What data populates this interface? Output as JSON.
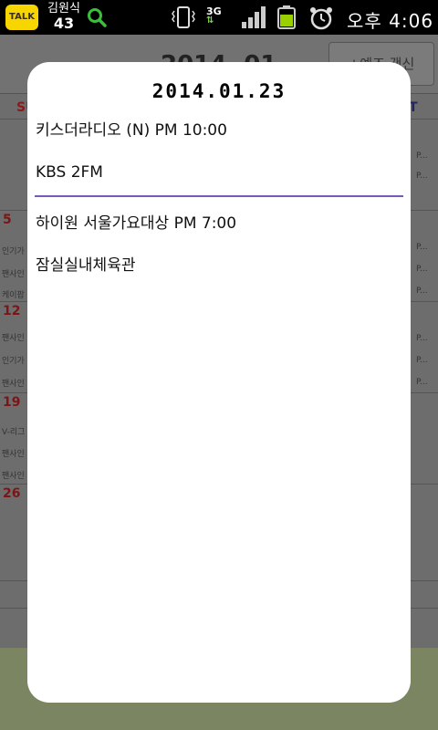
{
  "statusbar": {
    "talk_label": "TALK",
    "notif_name": "김원식",
    "notif_count": "43",
    "network_label": "3G",
    "time": "오후 4:06"
  },
  "background_app": {
    "month": "2014. 01",
    "action_button": "+예즈 갱신",
    "sunday_label": "SU",
    "saturday_label": "T",
    "days": [
      "5",
      "12",
      "19",
      "26"
    ],
    "left_items": [
      "인기가",
      "팬사인",
      "케이팝",
      "팬사인",
      "인기가",
      "팬사인",
      "V-리그",
      "팬사인",
      "팬사인"
    ],
    "right_items": [
      "P...",
      "P...",
      "P...",
      "P...",
      "P...",
      "P...",
      "P...",
      "P..."
    ]
  },
  "dialog": {
    "date": "2014.01.23",
    "events": [
      {
        "title": "키스더라디오 (N) PM 10:00",
        "location": "KBS 2FM"
      },
      {
        "title": "하이원 서울가요대상 PM 7:00",
        "location": "잠실실내체육관"
      }
    ]
  }
}
